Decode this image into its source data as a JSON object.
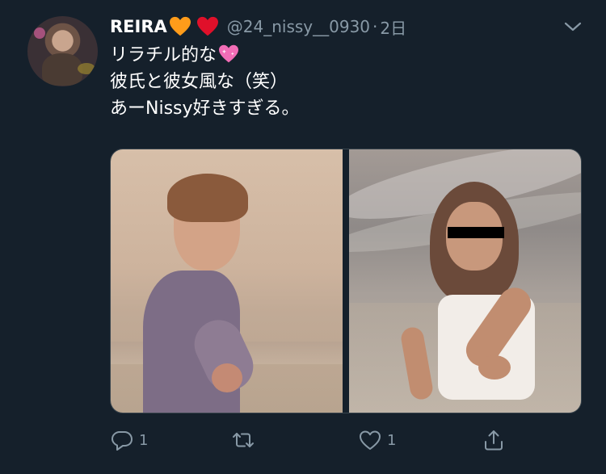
{
  "tweet": {
    "display_name": "REIRA",
    "handle": "@24_nissy__0930",
    "separator": "·",
    "time": "2日",
    "text_lines": [
      "リラチル的な",
      "彼氏と彼女風な（笑）",
      "あーNissy好きすぎる。"
    ],
    "name_emojis": [
      "orange-heart-icon",
      "red-heart-icon"
    ],
    "line_emoji": "sparkling-heart-icon"
  },
  "actions": {
    "reply_count": "1",
    "retweet_count": "",
    "like_count": "1"
  },
  "colors": {
    "background": "#15202b",
    "text_primary": "#ffffff",
    "text_secondary": "#8899a6",
    "border": "#38444d"
  }
}
